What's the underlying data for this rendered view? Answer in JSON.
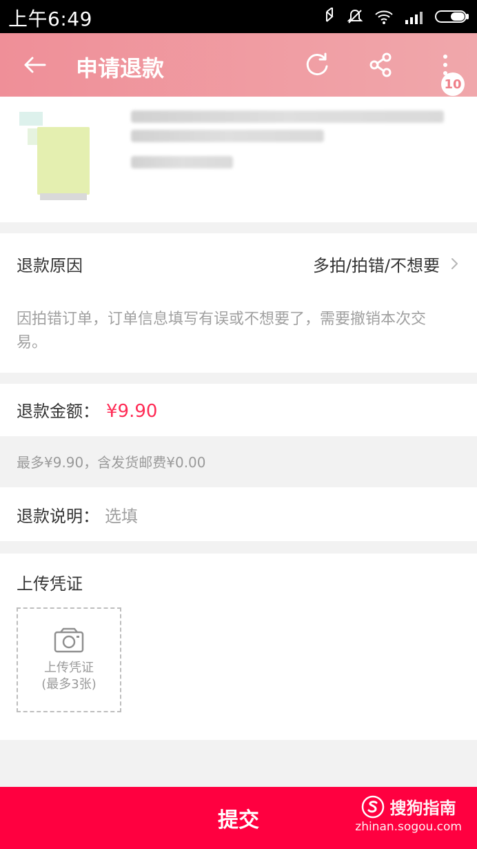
{
  "status": {
    "time": "上午6:49",
    "icons": [
      "bluetooth-icon",
      "mute-icon",
      "wifi-icon",
      "signal-icon",
      "battery-icon"
    ]
  },
  "header": {
    "title": "申请退款",
    "badge": "10",
    "icons": [
      "back-icon",
      "refresh-icon",
      "share-icon",
      "more-icon"
    ]
  },
  "reason": {
    "label": "退款原因",
    "value": "多拍/拍错/不想要",
    "description": "因拍错订单，订单信息填写有误或不想要了，需要撤销本次交易。"
  },
  "amount": {
    "label": "退款金额：",
    "value": "¥9.90",
    "note": "最多¥9.90，含发货邮费¥0.00"
  },
  "note": {
    "label": "退款说明：",
    "placeholder": "选填"
  },
  "upload": {
    "title": "上传凭证",
    "box_line1": "上传凭证",
    "box_line2": "(最多3张)"
  },
  "footer": {
    "submit": "提交"
  },
  "watermark": {
    "brand": "搜狗指南",
    "url": "zhinan.sogou.com"
  },
  "colors": {
    "header_gradient_start": "#ef8f98",
    "header_gradient_end": "#f0a7ab",
    "accent": "#ff0040",
    "price": "#ff2b55"
  }
}
